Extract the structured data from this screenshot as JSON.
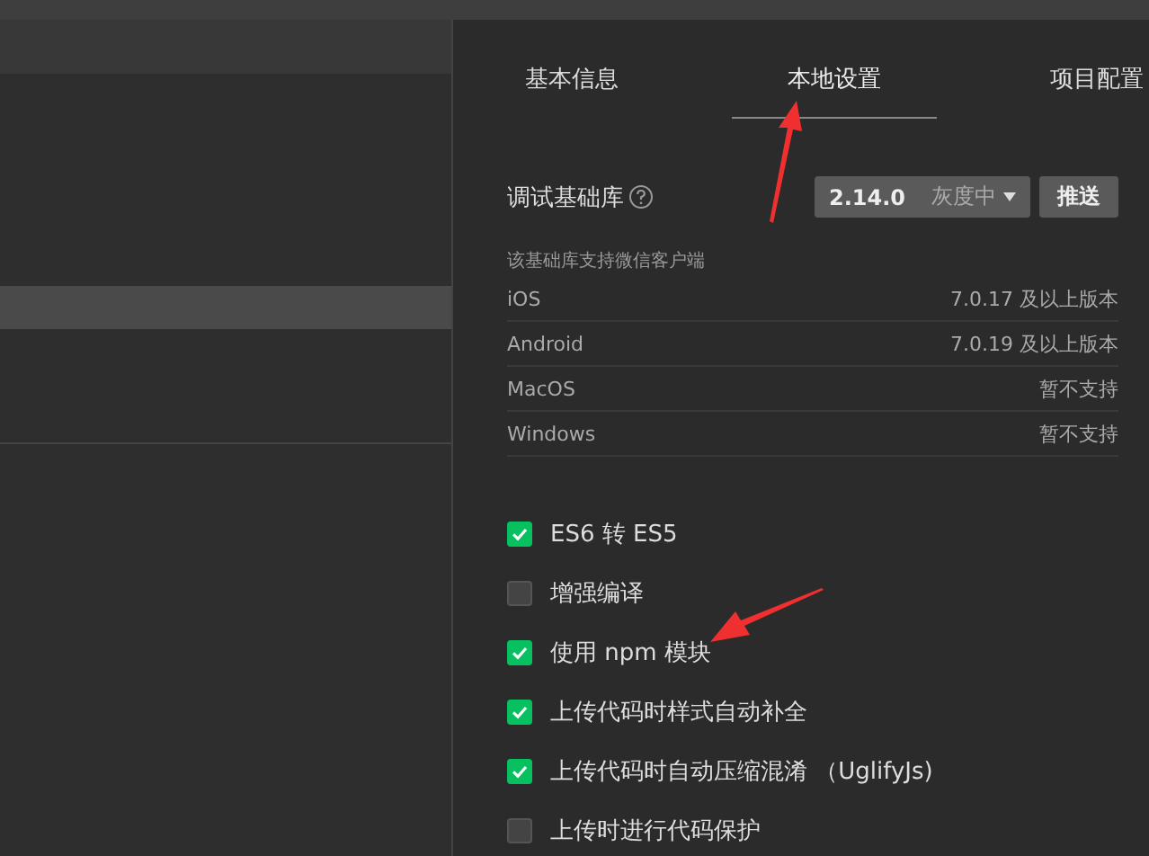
{
  "tabs": [
    {
      "label": "基本信息",
      "selected": false
    },
    {
      "label": "本地设置",
      "selected": true
    },
    {
      "label": "项目配置",
      "selected": false
    }
  ],
  "debug_library": {
    "label": "调试基础库",
    "version": "2.14.0",
    "channel": "灰度中",
    "push_button": "推送"
  },
  "support": {
    "heading": "该基础库支持微信客户端",
    "rows": [
      {
        "platform": "iOS",
        "requirement": "7.0.17 及以上版本"
      },
      {
        "platform": "Android",
        "requirement": "7.0.19 及以上版本"
      },
      {
        "platform": "MacOS",
        "requirement": "暂不支持"
      },
      {
        "platform": "Windows",
        "requirement": "暂不支持"
      }
    ]
  },
  "options": [
    {
      "label": "ES6 转 ES5",
      "checked": true
    },
    {
      "label": "增强编译",
      "checked": false
    },
    {
      "label": "使用 npm 模块",
      "checked": true
    },
    {
      "label": "上传代码时样式自动补全",
      "checked": true
    },
    {
      "label": "上传代码时自动压缩混淆 （UglifyJs)",
      "checked": true
    },
    {
      "label": "上传时进行代码保护",
      "checked": false
    }
  ]
}
